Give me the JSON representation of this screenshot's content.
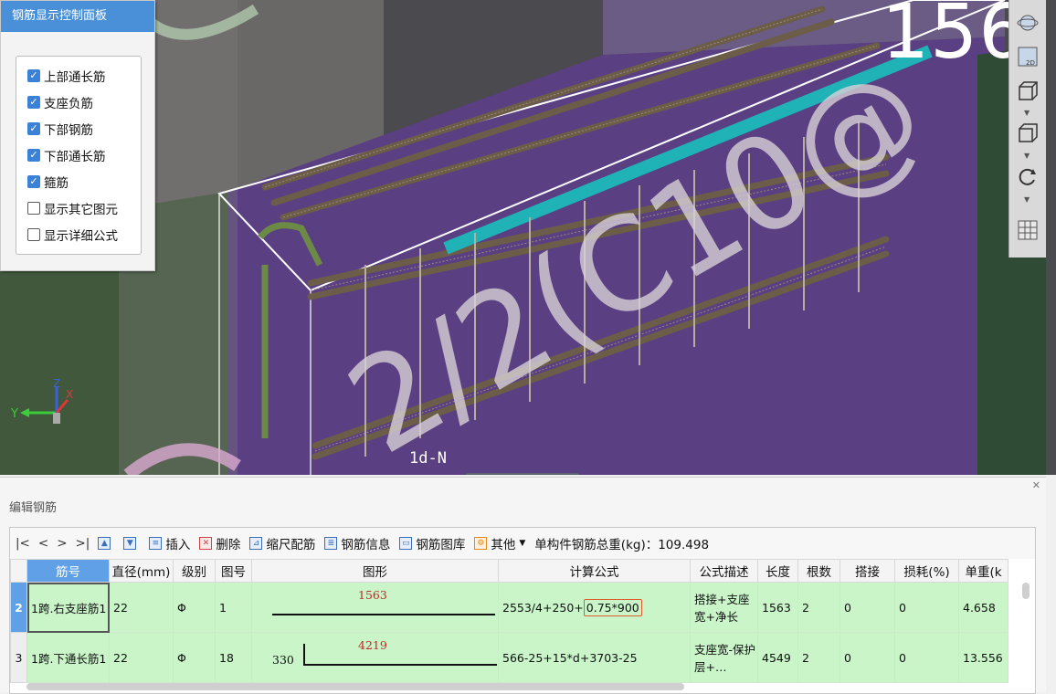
{
  "control_panel": {
    "title": "钢筋显示控制面板",
    "items": [
      {
        "label": "上部通长筋",
        "checked": true
      },
      {
        "label": "支座负筋",
        "checked": true
      },
      {
        "label": "下部钢筋",
        "checked": true
      },
      {
        "label": "下部通长筋",
        "checked": true
      },
      {
        "label": "箍筋",
        "checked": true
      },
      {
        "label": "显示其它图元",
        "checked": false
      },
      {
        "label": "显示详细公式",
        "checked": false
      }
    ]
  },
  "viewport": {
    "big_number": "156",
    "overlay_text": "2/2(C10@",
    "dim_label": "1d-N",
    "axis": {
      "x": "X",
      "y": "Y",
      "z": "Z"
    },
    "view_buttons": [
      "orbit-icon",
      "2d-icon",
      "cube-front-icon",
      "cube-iso-icon",
      "rotate-icon",
      "grid-icon"
    ],
    "view_2d_label": "2D"
  },
  "editor": {
    "title": "编辑钢筋",
    "toolbar": {
      "nav": [
        "|<",
        "<",
        ">",
        ">|"
      ],
      "insert": "插入",
      "delete": "删除",
      "scale": "缩尺配筋",
      "info": "钢筋信息",
      "library": "钢筋图库",
      "other": "其他",
      "total": "单构件钢筋总重(kg)：109.498"
    },
    "columns": [
      "筋号",
      "直径(mm)",
      "级别",
      "图号",
      "图形",
      "计算公式",
      "公式描述",
      "长度",
      "根数",
      "搭接",
      "损耗(%)",
      "单重(k"
    ],
    "rows": [
      {
        "index": "2",
        "name": "1跨.右支座筋1",
        "diameter": "22",
        "grade": "Φ",
        "fig_no": "1",
        "shape_value": "1563",
        "formula_a": "2553/4+250+",
        "formula_b": "0.75*900",
        "desc": "搭接+支座宽+净长",
        "length": "1563",
        "count": "2",
        "lap": "0",
        "loss": "0",
        "weight": "4.658"
      },
      {
        "index": "3",
        "name": "1跨.下通长筋1",
        "diameter": "22",
        "grade": "Φ",
        "fig_no": "18",
        "shape_hook": "330",
        "shape_value": "4219",
        "formula_a": "566-25+15*d+3703-25",
        "formula_b": "",
        "desc": "支座宽-保护层+…",
        "length": "4549",
        "count": "2",
        "lap": "0",
        "loss": "0",
        "weight": "13.556"
      }
    ]
  },
  "colors": {
    "panel_title": "#4a90d9",
    "row_green": "#c9f5c9",
    "highlight_cyan": "#1fb3b8",
    "purple_wall": "#5a3f83"
  }
}
